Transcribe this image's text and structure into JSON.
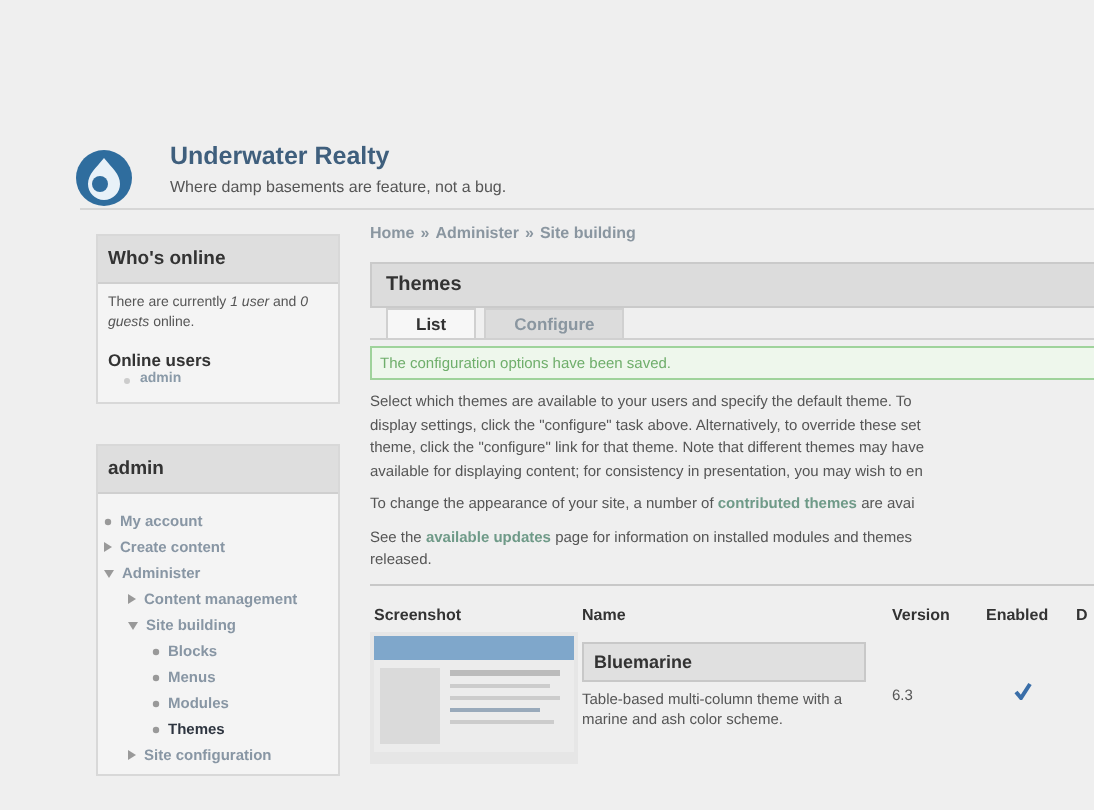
{
  "site": {
    "name": "Underwater Realty",
    "slogan": "Where damp basements are feature, not a bug."
  },
  "sidebar": {
    "blocks": [
      {
        "kind": "online",
        "title": "Who's online",
        "text": "There are currently *1 user* and *0 guests* online.",
        "subtitle": "Online users",
        "users": [
          "admin"
        ]
      },
      {
        "kind": "menu",
        "title": "admin",
        "items": [
          {
            "label": "My account",
            "kind": "leaf",
            "selected": false
          },
          {
            "label": "Create content",
            "kind": "collapsed",
            "selected": false
          },
          {
            "label": "Administer",
            "kind": "expanded",
            "selected": false,
            "children": [
              {
                "label": "Content management",
                "kind": "collapsed",
                "selected": false
              },
              {
                "label": "Site building",
                "kind": "expanded",
                "selected": false,
                "children": [
                  {
                    "label": "Blocks",
                    "kind": "leaf",
                    "selected": false
                  },
                  {
                    "label": "Menus",
                    "kind": "leaf",
                    "selected": false
                  },
                  {
                    "label": "Modules",
                    "kind": "leaf",
                    "selected": false
                  },
                  {
                    "label": "Themes",
                    "kind": "leaf",
                    "selected": true
                  }
                ]
              },
              {
                "label": "Site configuration",
                "kind": "collapsed",
                "selected": false
              }
            ]
          }
        ]
      }
    ]
  },
  "breadcrumb": [
    "Home",
    "Administer",
    "Site building"
  ],
  "breadcrumb_separator": "»",
  "page_title": "Themes",
  "tabs": [
    {
      "label": "List",
      "selected": true
    },
    {
      "label": "Configure",
      "selected": false
    }
  ],
  "message": "The configuration options have been saved.",
  "intro_lines": [
    "Select which themes are available to your users and specify the default theme. To",
    "display settings, click the \"configure\" task above. Alternatively, to override these set",
    "theme, click the \"configure\" link for that theme. Note that different themes may have",
    "available for displaying content; for consistency in presentation, you may wish to en"
  ],
  "contrib": {
    "before": "To change the appearance of your site, a number of",
    "link": "contributed themes",
    "after": "are avai"
  },
  "updates": {
    "before": "See the",
    "link": "available updates",
    "after": "page for information on installed modules and themes",
    "last_line": "released."
  },
  "table": {
    "columns": [
      "Screenshot",
      "Name",
      "Version",
      "Enabled",
      "D"
    ],
    "rows": [
      {
        "name": "Bluemarine",
        "description": "Table-based multi-column theme with a marine and ash color scheme.",
        "version": "6.3",
        "enabled": true
      }
    ]
  }
}
